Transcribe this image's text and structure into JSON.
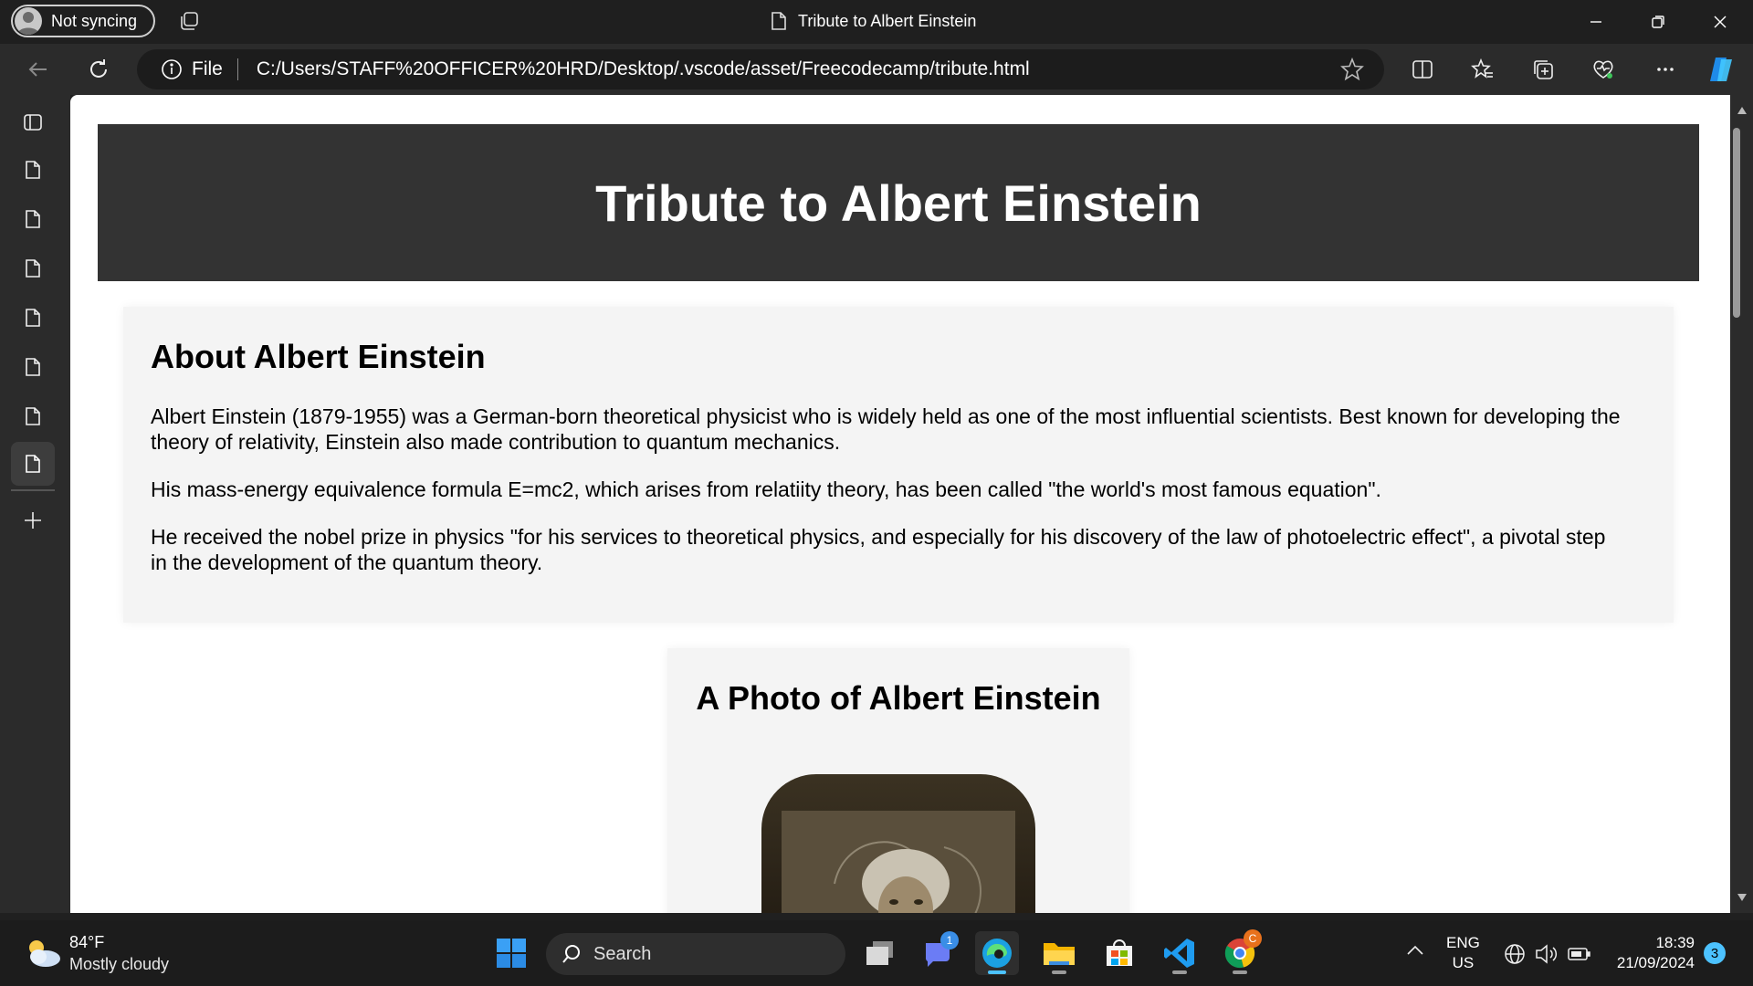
{
  "browser": {
    "profile_label": "Not syncing",
    "tab_title": "Tribute to Albert Einstein",
    "address_scheme": "File",
    "address_url": "C:/Users/STAFF%20OFFICER%20HRD/Desktop/.vscode/asset/Freecodecamp/tribute.html"
  },
  "page": {
    "title": "Tribute to Albert Einstein",
    "about_heading": "About Albert Einstein",
    "about_p1": "Albert Einstein (1879-1955) was a German-born theoretical physicist who is widely held as one of the most influential scientists. Best known for developing the theory of relativity, Einstein also made contribution to quantum mechanics.",
    "about_p2": "His mass-energy equivalence formula E=mc2, which arises from relatiity theory, has been called \"the world's most famous equation\".",
    "about_p3": "He received the nobel prize in physics \"for his services to theoretical physics, and especially for his discovery of the law of photoelectric effect\", a pivotal step in the development of the quantum theory.",
    "photo_heading": "A Photo of Albert Einstein"
  },
  "taskbar": {
    "weather_temp": "84°F",
    "weather_desc": "Mostly cloudy",
    "search_label": "Search",
    "teams_badge": "1",
    "chrome_badge": "C",
    "lang_top": "ENG",
    "lang_bottom": "US",
    "time": "18:39",
    "date": "21/09/2024",
    "notification_count": "3"
  },
  "colors": {
    "accent": "#4cc2ff",
    "header_band": "#333333",
    "card_bg": "#f4f4f4"
  }
}
